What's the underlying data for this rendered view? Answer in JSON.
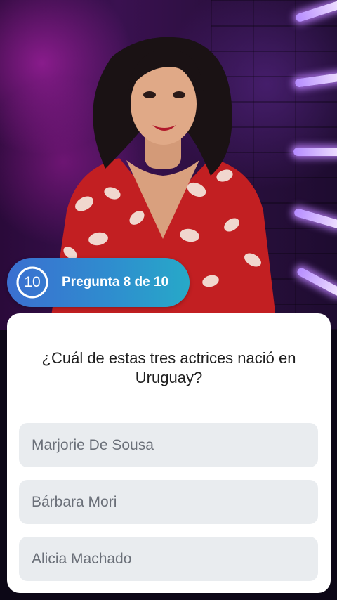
{
  "header": {
    "timer_value": "10",
    "question_counter": "Pregunta 8 de 10"
  },
  "question": {
    "text": "¿Cuál de estas tres actrices nació en Uruguay?"
  },
  "options": [
    {
      "label": "Marjorie De Sousa"
    },
    {
      "label": "Bárbara Mori"
    },
    {
      "label": "Alicia Machado"
    }
  ],
  "colors": {
    "badge_start": "#3b6fd0",
    "badge_end": "#27a9c8",
    "option_bg": "#e9ecef",
    "option_text": "#6b7079",
    "card_bg": "#ffffff"
  }
}
